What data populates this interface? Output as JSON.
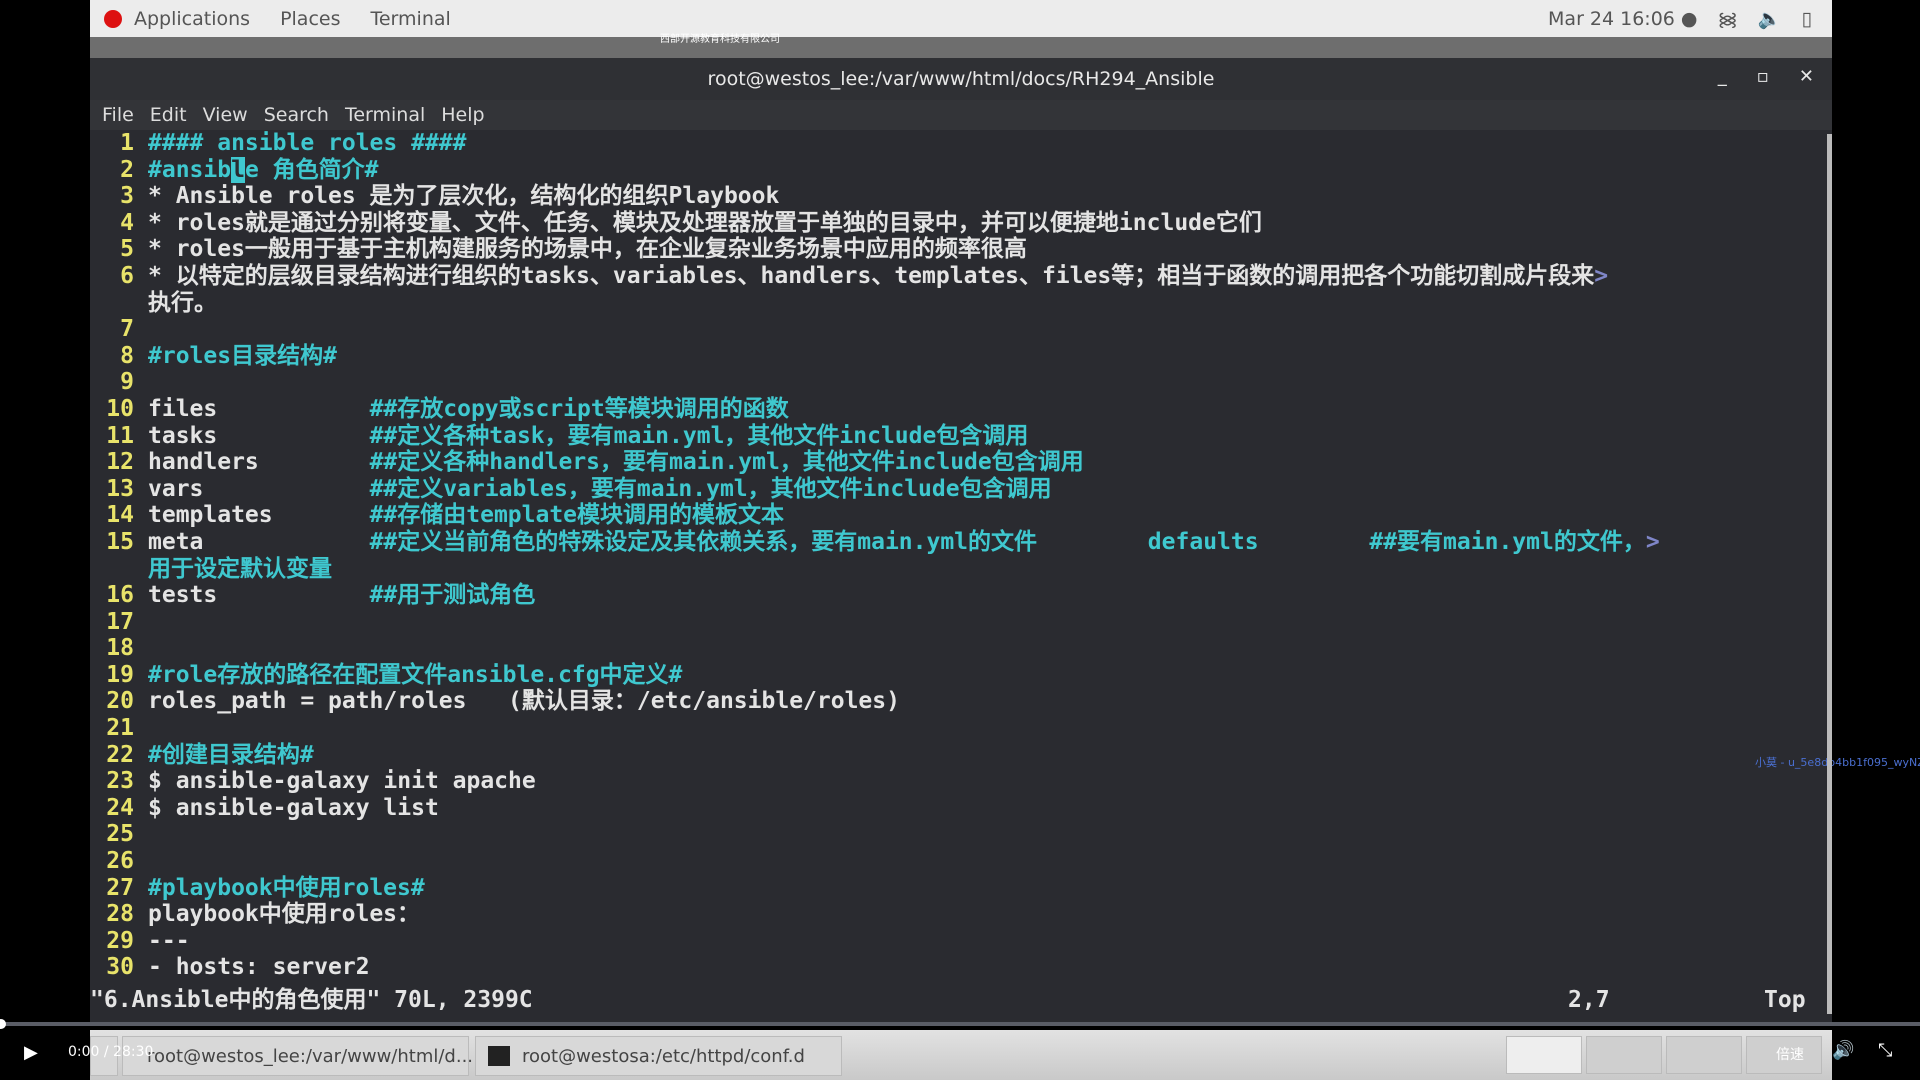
{
  "topbar": {
    "menus": [
      "Applications",
      "Places",
      "Terminal"
    ],
    "clock": "Mar 24  16:06 ●",
    "icons": [
      "wifi-icon",
      "volume-icon",
      "battery-icon"
    ]
  },
  "watermark_top": "西部开源教育科技有限公司",
  "window": {
    "title": "root@westos_lee:/var/www/html/docs/RH294_Ansible",
    "controls": {
      "minimize": "_",
      "maximize": "▫",
      "close": "✕"
    }
  },
  "menubar": [
    "File",
    "Edit",
    "View",
    "Search",
    "Terminal",
    "Help"
  ],
  "colors": {
    "background": "#2a2b30",
    "line_number": "#e8e36a",
    "comment": "#3fc8cf",
    "text": "#e4e4e4"
  },
  "editor": {
    "rows": [
      {
        "n": "1",
        "seg": [
          [
            "c",
            "#### ansible roles ####"
          ]
        ]
      },
      {
        "n": "2",
        "seg": [
          [
            "c",
            "#ansib"
          ],
          [
            "cur",
            "l"
          ],
          [
            "c",
            "e 角色简介#"
          ]
        ]
      },
      {
        "n": "3",
        "seg": [
          [
            "w",
            "* Ansible roles 是为了层次化，结构化的组织Playbook"
          ]
        ]
      },
      {
        "n": "4",
        "seg": [
          [
            "w",
            "* roles就是通过分别将变量、文件、任务、模块及处理器放置于单独的目录中，并可以便捷地include它们"
          ]
        ]
      },
      {
        "n": "5",
        "seg": [
          [
            "w",
            "* roles一般用于基于主机构建服务的场景中，在企业复杂业务场景中应用的频率很高"
          ]
        ]
      },
      {
        "n": "6",
        "seg": [
          [
            "w",
            "* 以特定的层级目录结构进行组织的tasks、variables、handlers、templates、files等；相当于函数的调用把各个功能切割成片段来"
          ],
          [
            "g",
            ">"
          ]
        ]
      },
      {
        "n": "",
        "seg": [
          [
            "w",
            "执行。"
          ]
        ]
      },
      {
        "n": "7",
        "seg": []
      },
      {
        "n": "8",
        "seg": [
          [
            "c",
            "#roles目录结构#"
          ]
        ]
      },
      {
        "n": "9",
        "seg": []
      },
      {
        "n": "10",
        "seg": [
          [
            "w",
            "files           "
          ],
          [
            "c",
            "##存放copy或script等模块调用的函数"
          ]
        ]
      },
      {
        "n": "11",
        "seg": [
          [
            "w",
            "tasks           "
          ],
          [
            "c",
            "##定义各种task，要有main.yml，其他文件include包含调用"
          ]
        ]
      },
      {
        "n": "12",
        "seg": [
          [
            "w",
            "handlers        "
          ],
          [
            "c",
            "##定义各种handlers，要有main.yml，其他文件include包含调用"
          ]
        ]
      },
      {
        "n": "13",
        "seg": [
          [
            "w",
            "vars            "
          ],
          [
            "c",
            "##定义variables，要有main.yml，其他文件include包含调用"
          ]
        ]
      },
      {
        "n": "14",
        "seg": [
          [
            "w",
            "templates       "
          ],
          [
            "c",
            "##存储由template模块调用的模板文本"
          ]
        ]
      },
      {
        "n": "15",
        "seg": [
          [
            "w",
            "meta            "
          ],
          [
            "c",
            "##定义当前角色的特殊设定及其依赖关系，要有main.yml的文件        defaults        ##要有main.yml的文件，"
          ],
          [
            "g",
            ">"
          ]
        ]
      },
      {
        "n": "",
        "seg": [
          [
            "c",
            "用于设定默认变量"
          ]
        ]
      },
      {
        "n": "16",
        "seg": [
          [
            "w",
            "tests           "
          ],
          [
            "c",
            "##用于测试角色"
          ]
        ]
      },
      {
        "n": "17",
        "seg": []
      },
      {
        "n": "18",
        "seg": []
      },
      {
        "n": "19",
        "seg": [
          [
            "c",
            "#role存放的路径在配置文件ansible.cfg中定义#"
          ]
        ]
      },
      {
        "n": "20",
        "seg": [
          [
            "w",
            "roles_path = path/roles   (默认目录：/etc/ansible/roles)"
          ]
        ]
      },
      {
        "n": "21",
        "seg": []
      },
      {
        "n": "22",
        "seg": [
          [
            "c",
            "#创建目录结构#"
          ]
        ]
      },
      {
        "n": "23",
        "seg": [
          [
            "w",
            "$ ansible-galaxy init apache"
          ]
        ]
      },
      {
        "n": "24",
        "seg": [
          [
            "w",
            "$ ansible-galaxy list"
          ]
        ]
      },
      {
        "n": "25",
        "seg": []
      },
      {
        "n": "26",
        "seg": []
      },
      {
        "n": "27",
        "seg": [
          [
            "c",
            "#playbook中使用roles#"
          ]
        ]
      },
      {
        "n": "28",
        "seg": [
          [
            "w",
            "playbook中使用roles："
          ]
        ]
      },
      {
        "n": "29",
        "seg": [
          [
            "w",
            "---"
          ]
        ]
      },
      {
        "n": "30",
        "seg": [
          [
            "w",
            "- hosts: server2"
          ]
        ]
      }
    ]
  },
  "status": {
    "file": "\"6.Ansible中的角色使用\" 70L, 2399C",
    "position": "2,7",
    "scroll": "Top"
  },
  "watermark_right": "小莫 - u_5e8db4bb1f095_wyNZc",
  "video": {
    "time": "0:00 / 28:30",
    "progress": 0,
    "speed": "倍速"
  },
  "taskbar": {
    "tasks": [
      "root@westos_lee:/var/www/html/d...",
      "root@westosa:/etc/httpd/conf.d"
    ]
  }
}
